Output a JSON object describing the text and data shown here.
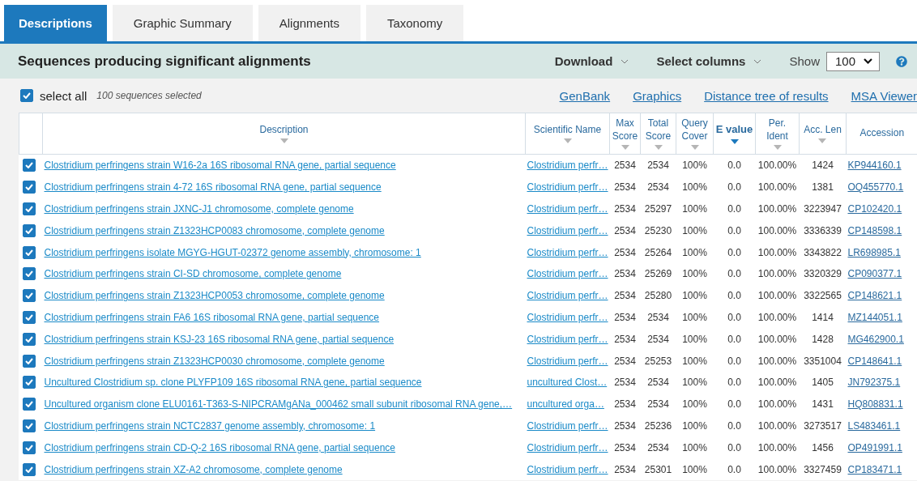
{
  "tabs": [
    {
      "label": "Descriptions",
      "selected": true
    },
    {
      "label": "Graphic Summary",
      "selected": false
    },
    {
      "label": "Alignments",
      "selected": false
    },
    {
      "label": "Taxonomy",
      "selected": false
    }
  ],
  "header": {
    "title": "Sequences producing significant alignments",
    "download": "Download",
    "select_columns": "Select columns",
    "show_label": "Show",
    "show_value": "100"
  },
  "toolbar": {
    "select_all": {
      "label": "select all",
      "checked": true
    },
    "selected_count": "100 sequences selected",
    "links": [
      "GenBank",
      "Graphics",
      "Distance tree of results",
      "MSA Viewer"
    ]
  },
  "table": {
    "columns": [
      {
        "label": "Description",
        "sortable": true,
        "sorted": false
      },
      {
        "label": "Scientific Name",
        "sortable": true,
        "sorted": false
      },
      {
        "label": "Max Score",
        "sortable": true,
        "sorted": false
      },
      {
        "label": "Total Score",
        "sortable": true,
        "sorted": false
      },
      {
        "label": "Query Cover",
        "sortable": true,
        "sorted": false
      },
      {
        "label": "E value",
        "sortable": true,
        "sorted": true
      },
      {
        "label": "Per. Ident",
        "sortable": true,
        "sorted": false
      },
      {
        "label": "Acc. Len",
        "sortable": true,
        "sorted": false
      },
      {
        "label": "Accession",
        "sortable": false,
        "sorted": false
      }
    ],
    "rows": [
      {
        "checked": true,
        "cells": [
          "Clostridium perfringens strain W16-2a 16S ribosomal RNA gene, partial sequence",
          "Clostridium perfr…",
          "2534",
          "2534",
          "100%",
          "0.0",
          "100.00%",
          "1424",
          "KP944160.1"
        ]
      },
      {
        "checked": true,
        "cells": [
          "Clostridium perfringens strain 4-72 16S ribosomal RNA gene, partial sequence",
          "Clostridium perfr…",
          "2534",
          "2534",
          "100%",
          "0.0",
          "100.00%",
          "1381",
          "OQ455770.1"
        ]
      },
      {
        "checked": true,
        "cells": [
          "Clostridium perfringens strain JXNC-J1 chromosome, complete genome",
          "Clostridium perfr…",
          "2534",
          "25297",
          "100%",
          "0.0",
          "100.00%",
          "3223947",
          "CP102420.1"
        ]
      },
      {
        "checked": true,
        "cells": [
          "Clostridium perfringens strain Z1323HCP0083 chromosome, complete genome",
          "Clostridium perfr…",
          "2534",
          "25230",
          "100%",
          "0.0",
          "100.00%",
          "3336339",
          "CP148598.1"
        ]
      },
      {
        "checked": true,
        "cells": [
          "Clostridium perfringens isolate MGYG-HGUT-02372 genome assembly, chromosome: 1",
          "Clostridium perfr…",
          "2534",
          "25264",
          "100%",
          "0.0",
          "100.00%",
          "3343822",
          "LR698985.1"
        ]
      },
      {
        "checked": true,
        "cells": [
          "Clostridium perfringens strain CI-SD chromosome, complete genome",
          "Clostridium perfr…",
          "2534",
          "25269",
          "100%",
          "0.0",
          "100.00%",
          "3320329",
          "CP090377.1"
        ]
      },
      {
        "checked": true,
        "cells": [
          "Clostridium perfringens strain Z1323HCP0053 chromosome, complete genome",
          "Clostridium perfr…",
          "2534",
          "25280",
          "100%",
          "0.0",
          "100.00%",
          "3322565",
          "CP148621.1"
        ]
      },
      {
        "checked": true,
        "cells": [
          "Clostridium perfringens strain FA6 16S ribosomal RNA gene, partial sequence",
          "Clostridium perfr…",
          "2534",
          "2534",
          "100%",
          "0.0",
          "100.00%",
          "1414",
          "MZ144051.1"
        ]
      },
      {
        "checked": true,
        "cells": [
          "Clostridium perfringens strain KSJ-23 16S ribosomal RNA gene, partial sequence",
          "Clostridium perfr…",
          "2534",
          "2534",
          "100%",
          "0.0",
          "100.00%",
          "1428",
          "MG462900.1"
        ]
      },
      {
        "checked": true,
        "cells": [
          "Clostridium perfringens strain Z1323HCP0030 chromosome, complete genome",
          "Clostridium perfr…",
          "2534",
          "25253",
          "100%",
          "0.0",
          "100.00%",
          "3351004",
          "CP148641.1"
        ]
      },
      {
        "checked": true,
        "cells": [
          "Uncultured Clostridium sp. clone PLYFP109 16S ribosomal RNA gene, partial sequence",
          "uncultured Clost…",
          "2534",
          "2534",
          "100%",
          "0.0",
          "100.00%",
          "1405",
          "JN792375.1"
        ]
      },
      {
        "checked": true,
        "cells": [
          "Uncultured organism clone ELU0161-T363-S-NIPCRAMgANa_000462 small subunit ribosomal RNA gene,…",
          "uncultured orga…",
          "2534",
          "2534",
          "100%",
          "0.0",
          "100.00%",
          "1431",
          "HQ808831.1"
        ]
      },
      {
        "checked": true,
        "cells": [
          "Clostridium perfringens strain NCTC2837 genome assembly, chromosome: 1",
          "Clostridium perfr…",
          "2534",
          "25236",
          "100%",
          "0.0",
          "100.00%",
          "3273517",
          "LS483461.1"
        ]
      },
      {
        "checked": true,
        "cells": [
          "Clostridium perfringens strain CD-Q-2 16S ribosomal RNA gene, partial sequence",
          "Clostridium perfr…",
          "2534",
          "2534",
          "100%",
          "0.0",
          "100.00%",
          "1456",
          "OP491991.1"
        ]
      },
      {
        "checked": true,
        "cells": [
          "Clostridium perfringens strain XZ-A2 chromosome, complete genome",
          "Clostridium perfr…",
          "2534",
          "25301",
          "100%",
          "0.0",
          "100.00%",
          "3327459",
          "CP183471.1"
        ]
      }
    ]
  }
}
